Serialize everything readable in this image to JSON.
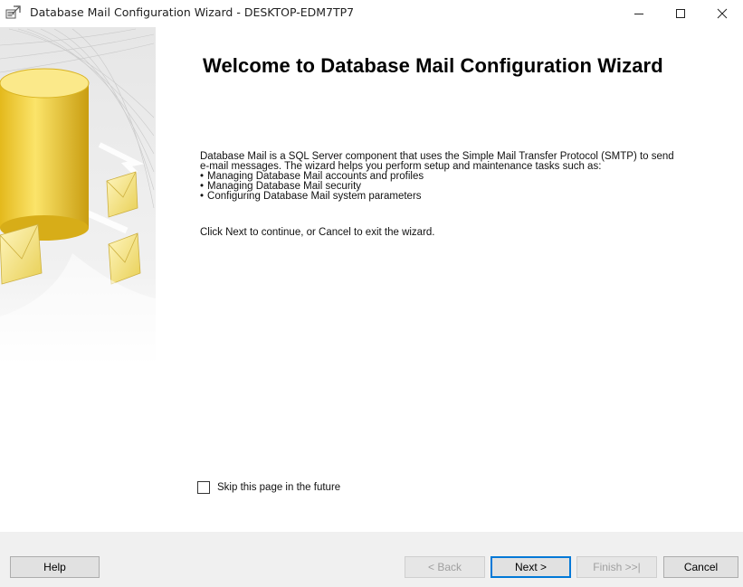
{
  "window": {
    "title": "Database Mail Configuration Wizard - DESKTOP-EDM7TP7"
  },
  "page": {
    "heading": "Welcome to Database Mail Configuration Wizard",
    "description_lines": [
      "Database Mail is a SQL Server component that uses the Simple Mail Transfer Protocol (SMTP) to send",
      "e-mail messages. The wizard helps you perform setup and maintenance tasks such as:"
    ],
    "tasks": [
      "Managing Database Mail accounts and profiles",
      "Managing Database Mail security",
      "Configuring Database Mail system parameters"
    ],
    "instruction": "Click Next to continue, or Cancel to exit the wizard.",
    "skip_label": "Skip this page in the future",
    "skip_checked": false
  },
  "buttons": {
    "help": "Help",
    "back": "< Back",
    "next": "Next >",
    "finish": "Finish >>|",
    "cancel": "Cancel"
  },
  "colors": {
    "accent": "#0078d7",
    "footer_bg": "#f0f0f0",
    "cylinder": "#f2d43a"
  },
  "icons": {
    "app": "wizard-app-icon",
    "minimize": "minimize-icon",
    "maximize": "maximize-icon",
    "close": "close-icon"
  }
}
